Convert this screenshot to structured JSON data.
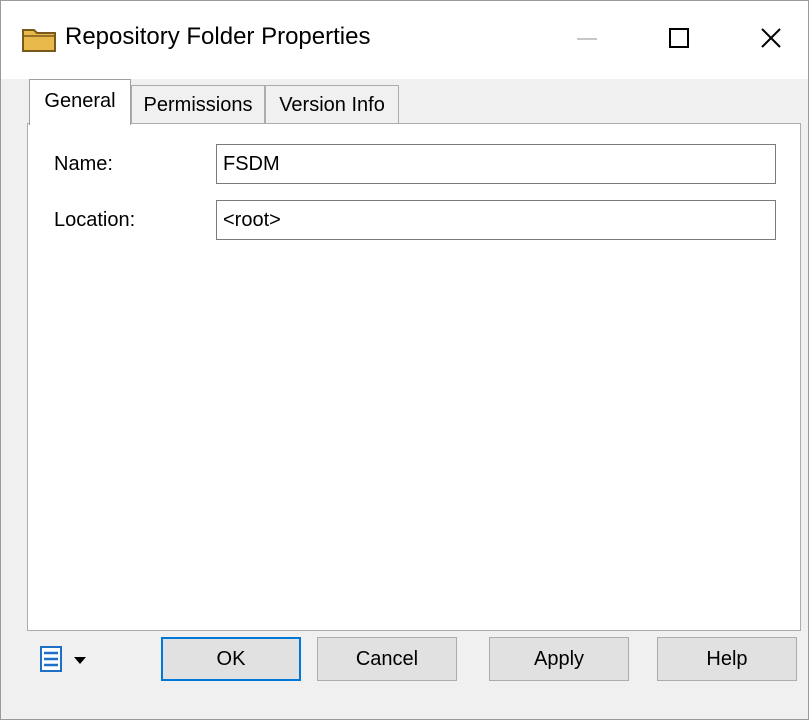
{
  "window": {
    "title": "Repository Folder Properties",
    "icon": "folder-icon",
    "controls": [
      "minimize-icon",
      "maximize-icon",
      "close-icon"
    ]
  },
  "tabs": [
    {
      "label": "General",
      "selected": true
    },
    {
      "label": "Permissions",
      "selected": false
    },
    {
      "label": "Version Info",
      "selected": false
    }
  ],
  "form": {
    "name_label": "Name:",
    "name_value": "FSDM",
    "location_label": "Location:",
    "location_value": "<root>"
  },
  "footer": {
    "menu_icon": "property-sheet-menu-icon",
    "ok_label": "OK",
    "cancel_label": "Cancel",
    "apply_label": "Apply",
    "help_label": "Help"
  },
  "colors": {
    "accent": "#0078d7",
    "folder": "#e8b84a",
    "menu_icon": "#1e6fc8"
  }
}
